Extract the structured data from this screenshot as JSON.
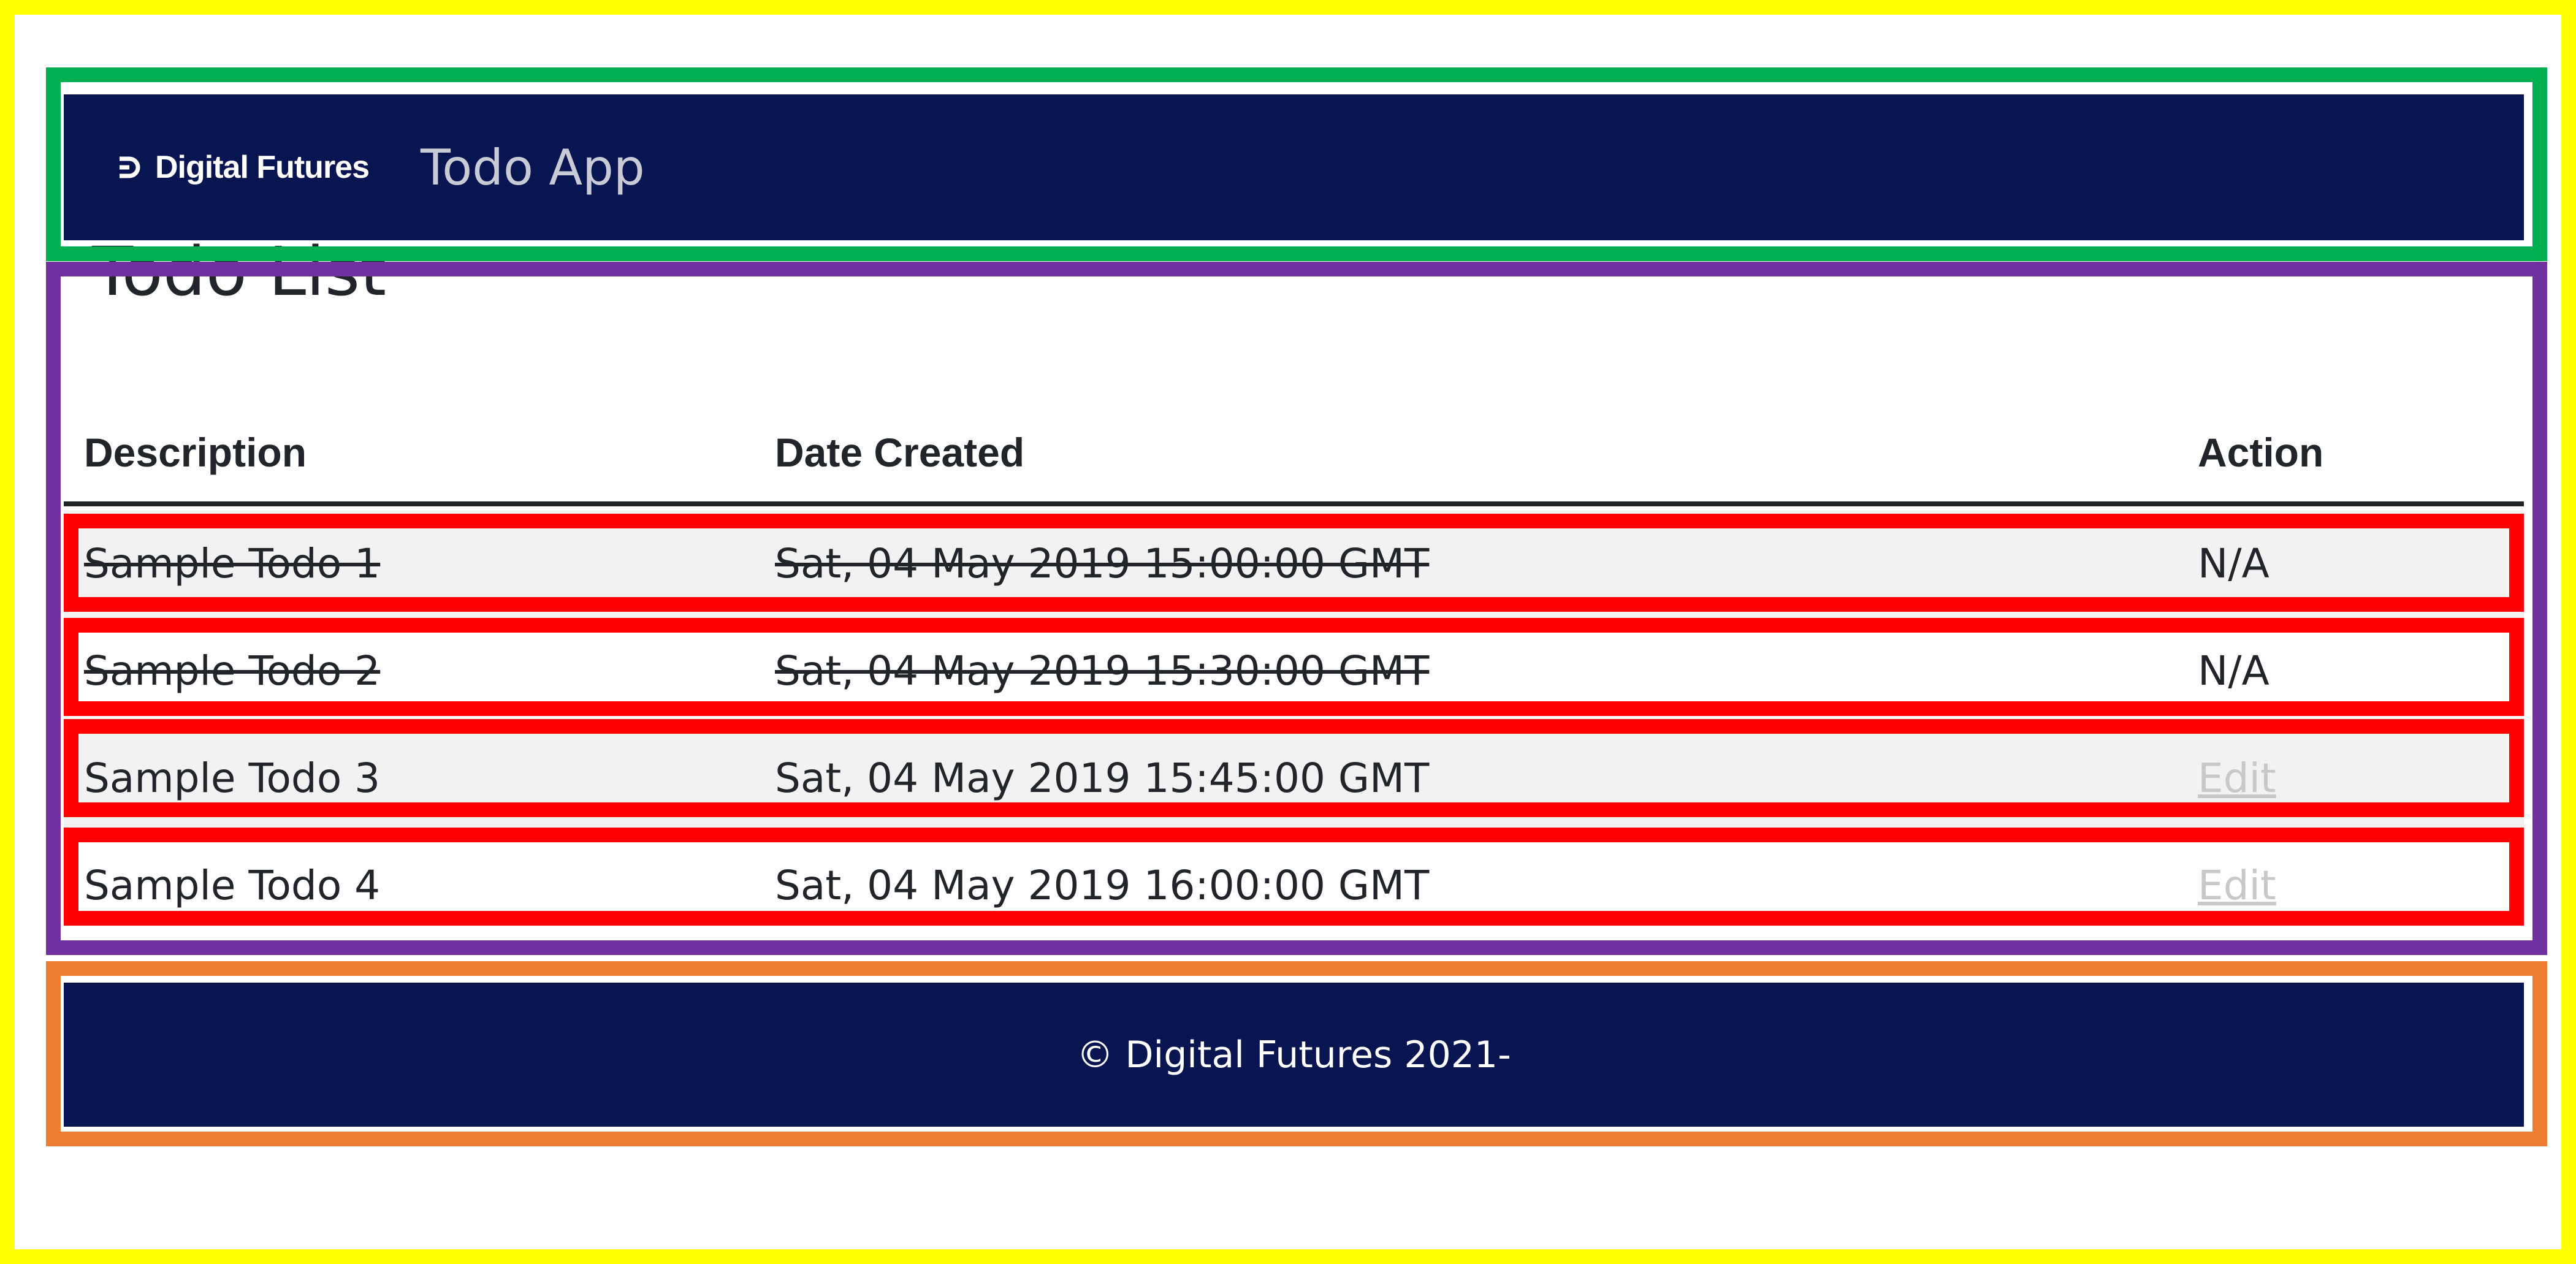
{
  "header": {
    "brand": "Digital Futures",
    "brand_icon": "digital-futures-logo-icon",
    "app_title": "Todo App"
  },
  "page": {
    "title": "Todo List"
  },
  "table": {
    "columns": [
      "Description",
      "Date Created",
      "Action"
    ],
    "rows": [
      {
        "description": "Sample Todo 1",
        "date_created": "Sat, 04 May 2019 15:00:00 GMT",
        "action": "N/A",
        "completed": true
      },
      {
        "description": "Sample Todo 2",
        "date_created": "Sat, 04 May 2019 15:30:00 GMT",
        "action": "N/A",
        "completed": true
      },
      {
        "description": "Sample Todo 3",
        "date_created": "Sat, 04 May 2019 15:45:00 GMT",
        "action": "Edit",
        "completed": false
      },
      {
        "description": "Sample Todo 4",
        "date_created": "Sat, 04 May 2019 16:00:00 GMT",
        "action": "Edit",
        "completed": false
      }
    ]
  },
  "footer": {
    "text": "© Digital Futures 2021-"
  },
  "colors": {
    "navbar_bg": "#081551",
    "row_stripe": "#f2f2f2",
    "edit_link": "#c8c8c8"
  }
}
